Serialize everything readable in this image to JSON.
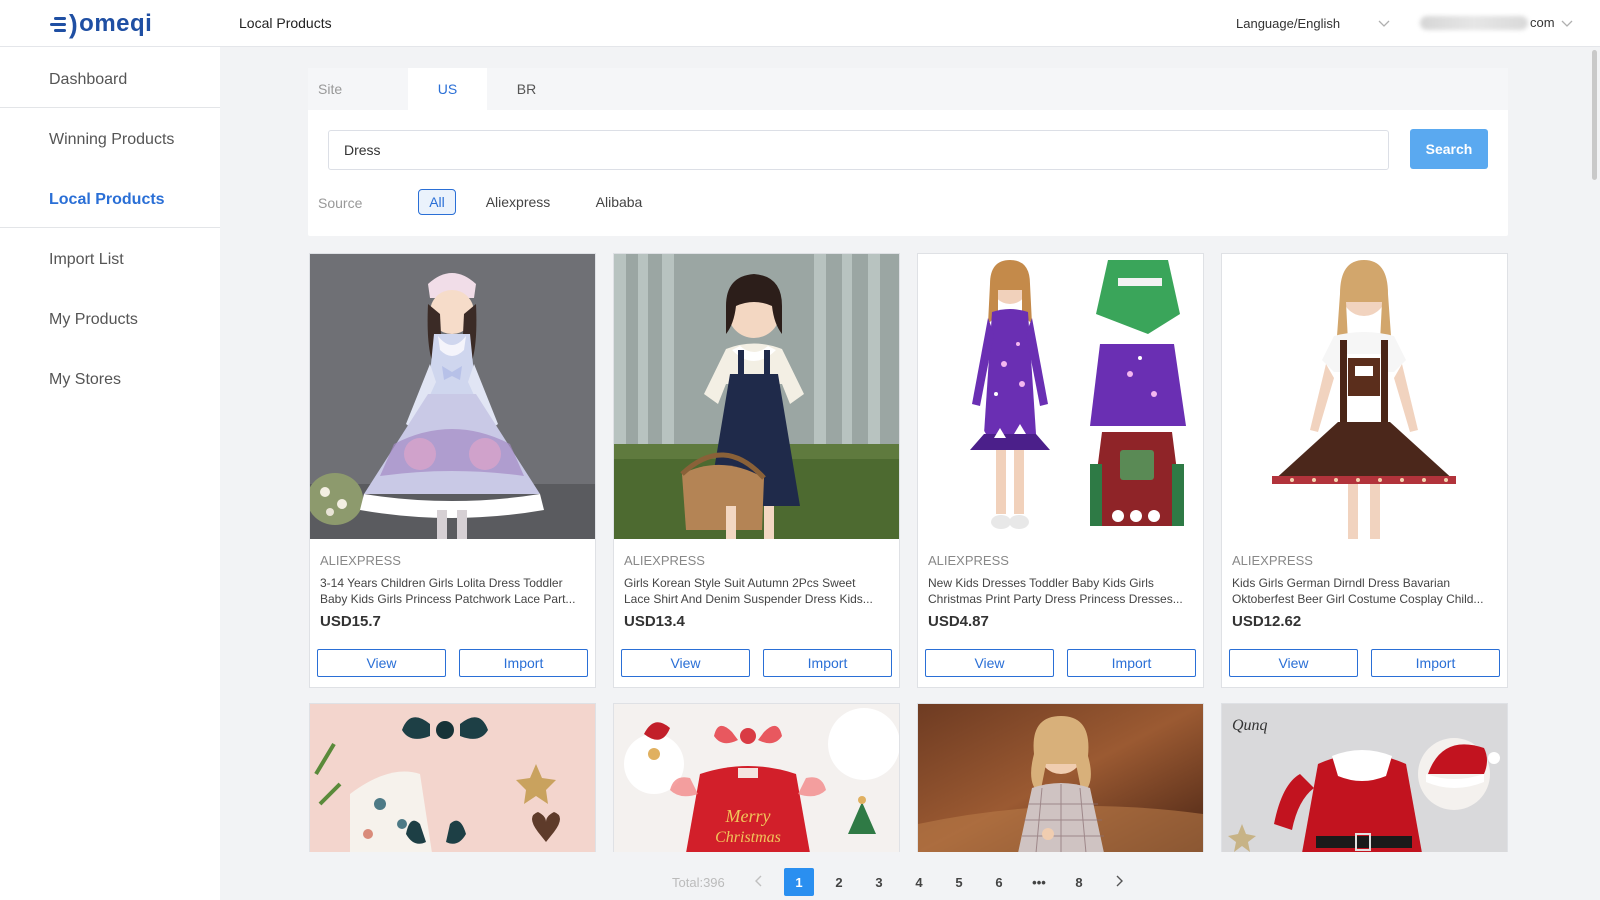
{
  "app": {
    "logo_text": "omeqi",
    "page_heading": "Local Products",
    "language_label": "Language/English",
    "account_suffix": "com"
  },
  "sidebar": {
    "items": [
      {
        "label": "Dashboard"
      },
      {
        "label": "Winning Products"
      },
      {
        "label": "Local Products",
        "active": true
      },
      {
        "label": "Import List"
      },
      {
        "label": "My Products"
      },
      {
        "label": "My Stores"
      }
    ]
  },
  "filters": {
    "site_label": "Site",
    "sites": [
      "US",
      "BR"
    ],
    "active_site": "US",
    "search_value": "Dress",
    "search_button": "Search",
    "source_label": "Source",
    "sources": [
      "All",
      "Aliexpress",
      "Alibaba"
    ],
    "active_source": "All"
  },
  "products": [
    {
      "source": "ALIEXPRESS",
      "title_line1": "3-14 Years Children Girls Lolita Dress Toddler",
      "title_line2": "Baby Kids Girls Princess Patchwork Lace Part...",
      "price": "USD15.7",
      "view_label": "View",
      "import_label": "Import"
    },
    {
      "source": "ALIEXPRESS",
      "title_line1": "Girls Korean Style Suit Autumn 2Pcs Sweet",
      "title_line2": "Lace Shirt And Denim Suspender Dress Kids...",
      "price": "USD13.4",
      "view_label": "View",
      "import_label": "Import"
    },
    {
      "source": "ALIEXPRESS",
      "title_line1": "New Kids Dresses Toddler Baby Kids Girls",
      "title_line2": "Christmas Print Party Dress Princess Dresses...",
      "price": "USD4.87",
      "view_label": "View",
      "import_label": "Import"
    },
    {
      "source": "ALIEXPRESS",
      "title_line1": "Kids Girls German Dirndl Dress Bavarian",
      "title_line2": "Oktoberfest Beer Girl Costume Cosplay Child...",
      "price": "USD12.62",
      "view_label": "View",
      "import_label": "Import"
    }
  ],
  "partial_row": {
    "brand_watermark": "Qunq",
    "merry_text": "Merry",
    "christmas_text": "Christmas"
  },
  "pagination": {
    "total_label": "Total:396",
    "pages": [
      "1",
      "2",
      "3",
      "4",
      "5",
      "6",
      "•••",
      "8"
    ],
    "current": "1"
  },
  "colors": {
    "accent": "#2a6fd6",
    "search_button": "#5aa9f0",
    "page_active": "#2a8ff0"
  }
}
